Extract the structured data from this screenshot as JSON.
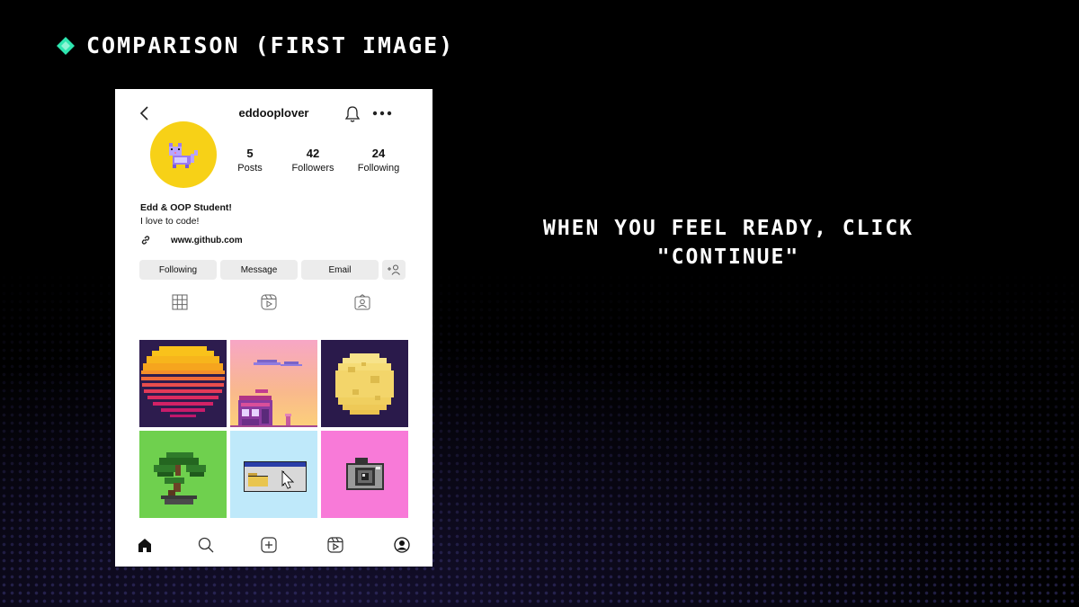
{
  "slide": {
    "title": "COMPARISON (FIRST IMAGE)",
    "instruction": "WHEN YOU FEEL READY, CLICK \"CONTINUE\"",
    "accent_color": "#2ee6b0"
  },
  "profile": {
    "username": "eddooplover",
    "stats": [
      {
        "value": "5",
        "label": "Posts"
      },
      {
        "value": "42",
        "label": "Followers"
      },
      {
        "value": "24",
        "label": "Following"
      }
    ],
    "bio_name": "Edd & OOP Student!",
    "bio_text": "I love to code!",
    "link": "www.github.com",
    "buttons": {
      "following": "Following",
      "message": "Message",
      "email": "Email"
    },
    "icons": {
      "back": "chevron-left-icon",
      "bell": "bell-icon",
      "more": "more-dots-icon",
      "link": "link-icon",
      "add_user": "add-user-icon",
      "grid_tab": "grid-icon",
      "reels_tab": "reels-icon",
      "tagged_tab": "tagged-icon",
      "nav": [
        "home-icon",
        "search-icon",
        "new-post-icon",
        "reels-icon",
        "profile-icon"
      ]
    },
    "avatar_color": "#f7d117",
    "posts": [
      "pixel-sunset",
      "pixel-house",
      "pixel-moon",
      "pixel-bonsai",
      "pixel-folder-window",
      "pixel-camera"
    ]
  }
}
